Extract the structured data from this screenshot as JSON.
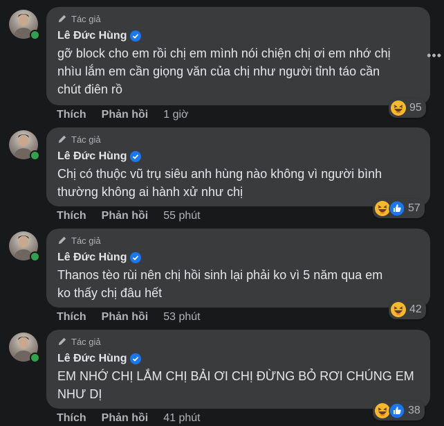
{
  "comments": [
    {
      "author_badge": "Tác giả",
      "name": "Lê Đức Hùng",
      "text_lines": [
        "gỡ block cho em rồi chị em mình nói chiện chị ơi em nhớ chị",
        "nhìu lắm em cần giọng văn của chị như người tỉnh táo cần",
        "chút điên rồ"
      ],
      "like_label": "Thích",
      "reply_label": "Phản hồi",
      "time": "1 giờ",
      "reactions": [
        "haha"
      ],
      "reaction_count": "95"
    },
    {
      "author_badge": "Tác giả",
      "name": "Lê Đức Hùng",
      "text_lines": [
        "Chị có thuộc vũ trụ siêu anh hùng nào không vì người bình",
        "thường không ai hành xử như chị"
      ],
      "like_label": "Thích",
      "reply_label": "Phản hồi",
      "time": "55 phút",
      "reactions": [
        "haha",
        "like"
      ],
      "reaction_count": "57"
    },
    {
      "author_badge": "Tác giả",
      "name": "Lê Đức Hùng",
      "text_lines": [
        "Thanos tèo rùi nên chị hồi sinh lại phải ko vì 5 năm qua em",
        "ko thấy chị đâu hết"
      ],
      "like_label": "Thích",
      "reply_label": "Phản hồi",
      "time": "53 phút",
      "reactions": [
        "haha"
      ],
      "reaction_count": "42"
    },
    {
      "author_badge": "Tác giả",
      "name": "Lê Đức Hùng",
      "text_lines": [
        "EM NHỚ CHỊ LẮM CHỊ BẢI ƠI CHỊ ĐỪNG BỎ RƠI CHÚNG EM",
        "NHƯ DỊ"
      ],
      "like_label": "Thích",
      "reply_label": "Phản hồi",
      "time": "41 phút",
      "reactions": [
        "haha",
        "like"
      ],
      "reaction_count": "38"
    }
  ],
  "colors": {
    "background": "#18191a",
    "bubble": "#3a3b3c",
    "verified": "#1877f2",
    "online": "#31a24c"
  }
}
